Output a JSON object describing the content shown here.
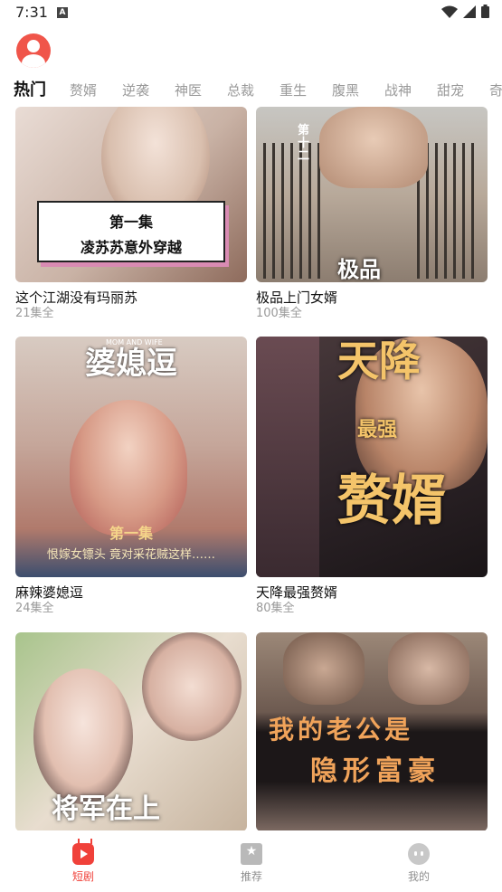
{
  "status": {
    "time": "7:31",
    "indicator": "A"
  },
  "tabs": [
    {
      "label": "热门",
      "active": true
    },
    {
      "label": "赘婿",
      "active": false
    },
    {
      "label": "逆袭",
      "active": false
    },
    {
      "label": "神医",
      "active": false
    },
    {
      "label": "总裁",
      "active": false
    },
    {
      "label": "重生",
      "active": false
    },
    {
      "label": "腹黑",
      "active": false
    },
    {
      "label": "战神",
      "active": false
    },
    {
      "label": "甜宠",
      "active": false
    },
    {
      "label": "奇",
      "active": false
    }
  ],
  "cards": [
    {
      "title": "这个江湖没有玛丽苏",
      "episodes": "21集全",
      "poster_line1": "第一集",
      "poster_line2": "凌苏苏意外穿越"
    },
    {
      "title": "极品上门女婿",
      "episodes": "100集全",
      "poster_title": "极品",
      "poster_vertical": "第十二"
    },
    {
      "title": "麻辣婆媳逗",
      "episodes": "24集全",
      "poster_title": "婆媳逗",
      "poster_small": "MOM AND WIFE",
      "poster_line1": "第一集",
      "poster_line2": "恨嫁女镖头 竟对采花贼这样……"
    },
    {
      "title": "天降最强赘婿",
      "episodes": "80集全",
      "poster_w1": "天降",
      "poster_w2": "最强",
      "poster_w3": "赘婿"
    },
    {
      "title": "将军在上",
      "episodes": "",
      "poster_title": "将军在上"
    },
    {
      "title": "我的老公是隐形富豪",
      "episodes": "",
      "poster_line1": "我的老公是",
      "poster_line2": "隐形富豪"
    }
  ],
  "bottom_nav": [
    {
      "label": "短剧",
      "icon": "play-icon",
      "active": true
    },
    {
      "label": "推荐",
      "icon": "star-icon",
      "active": false
    },
    {
      "label": "我的",
      "icon": "face-icon",
      "active": false
    }
  ],
  "colors": {
    "accent": "#f0413a",
    "inactive": "#8f8f8f"
  }
}
